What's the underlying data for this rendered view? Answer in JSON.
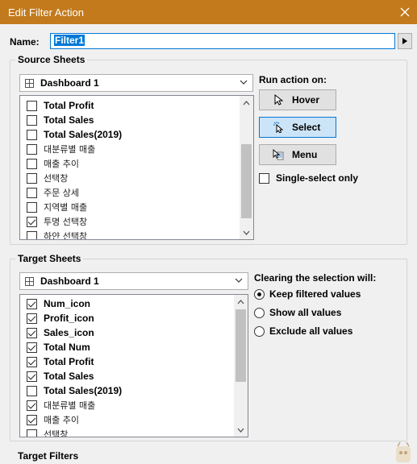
{
  "window": {
    "title": "Edit Filter Action"
  },
  "name": {
    "label": "Name:",
    "value": "Filter1"
  },
  "source": {
    "group_label": "Source Sheets",
    "dropdown": "Dashboard 1",
    "sheets": [
      {
        "label": "Total Profit",
        "checked": false,
        "kr": false
      },
      {
        "label": "Total Sales",
        "checked": false,
        "kr": false
      },
      {
        "label": "Total Sales(2019)",
        "checked": false,
        "kr": false
      },
      {
        "label": "대분류별 매출",
        "checked": false,
        "kr": true
      },
      {
        "label": "매출 추이",
        "checked": false,
        "kr": true
      },
      {
        "label": "선택창",
        "checked": false,
        "kr": true
      },
      {
        "label": "주문 상세",
        "checked": false,
        "kr": true
      },
      {
        "label": "지역별 매출",
        "checked": false,
        "kr": true
      },
      {
        "label": "투명 선택창",
        "checked": true,
        "kr": true
      },
      {
        "label": "하얀 선택창",
        "checked": false,
        "kr": true
      }
    ]
  },
  "run_action": {
    "label": "Run action on:",
    "buttons": [
      {
        "label": "Hover",
        "icon": "cursor-arrow-icon",
        "active": false
      },
      {
        "label": "Select",
        "icon": "cursor-click-icon",
        "active": true
      },
      {
        "label": "Menu",
        "icon": "cursor-menu-icon",
        "active": false
      }
    ],
    "single_select": {
      "label": "Single-select only",
      "checked": false
    }
  },
  "target": {
    "group_label": "Target Sheets",
    "dropdown": "Dashboard 1",
    "sheets": [
      {
        "label": "Num_icon",
        "checked": true,
        "kr": false
      },
      {
        "label": "Profit_icon",
        "checked": true,
        "kr": false
      },
      {
        "label": "Sales_icon",
        "checked": true,
        "kr": false
      },
      {
        "label": "Total Num",
        "checked": true,
        "kr": false
      },
      {
        "label": "Total Profit",
        "checked": true,
        "kr": false
      },
      {
        "label": "Total Sales",
        "checked": true,
        "kr": false
      },
      {
        "label": "Total Sales(2019)",
        "checked": false,
        "kr": false
      },
      {
        "label": "대분류별 매출",
        "checked": true,
        "kr": true
      },
      {
        "label": "매출 추이",
        "checked": true,
        "kr": true
      },
      {
        "label": "선택창",
        "checked": false,
        "kr": true
      }
    ]
  },
  "clearing": {
    "label": "Clearing the selection will:",
    "options": [
      {
        "label": "Keep filtered values",
        "selected": true
      },
      {
        "label": "Show all values",
        "selected": false
      },
      {
        "label": "Exclude all values",
        "selected": false
      }
    ]
  },
  "target_filters": {
    "group_label": "Target Filters"
  },
  "colors": {
    "titlebar": "#c27a1c",
    "selection": "#0078d7",
    "active_button": "#cce4f7"
  }
}
